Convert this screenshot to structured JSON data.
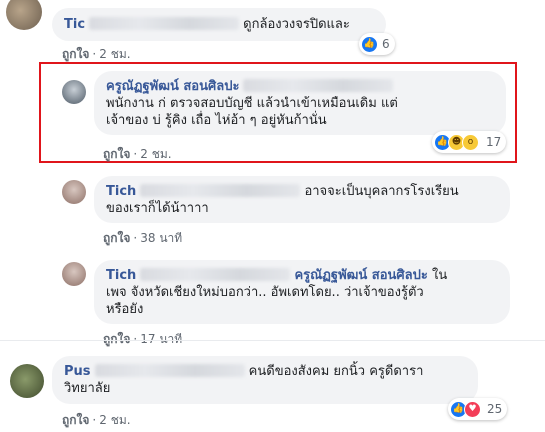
{
  "comments": [
    {
      "name": "Tic",
      "text": "ดูกล้องวงจรปิดและ",
      "like_label": "ถูกใจ",
      "time": "2 ชม.",
      "reaction_count": "6",
      "reactions": [
        "like-icon"
      ]
    },
    {
      "name": "ครูณัฏฐพัฒน์ สอนศิลปะ",
      "text_line1": "พนักงาน ก่ ตรวจสอบบัญชี แล้วนำเข้าเหมือนเดิม แต่",
      "text_line2": "เจ้าของ บ่ รู้คิง เถื่อ ไห่อ้า ๆ อยู่หันก้านั่น",
      "like_label": "ถูกใจ",
      "time": "2 ชม.",
      "reaction_count": "17",
      "reactions": [
        "like-icon",
        "haha-icon",
        "wow-icon"
      ]
    },
    {
      "name": "Tich",
      "text_line1": "อาจจะเป็นบุคลากรโรงเรียน",
      "text_line2": "ของเราก็ได้น้าาาา",
      "like_label": "ถูกใจ",
      "time": "38 นาที"
    },
    {
      "name": "Tich",
      "mention": "ครูณัฏฐพัฒน์ สอนศิลปะ",
      "text_line1_tail": "ใน",
      "text_line2": "เพจ จังหวัดเชียงใหม่บอกว่า.. อัพเดทโดย.. ว่าเจ้าของรู้ตัว",
      "text_line3": "หรือยัง",
      "like_label": "ถูกใจ",
      "time": "17 นาที"
    },
    {
      "name": "Pus",
      "text_line1": "คนดีของสังคม ยกนิ้ว ครูดีดารา",
      "text_line2": "วิทยาลัย",
      "like_label": "ถูกใจ",
      "time": "2 ชม.",
      "reaction_count": "25",
      "reactions": [
        "like-icon",
        "love-icon"
      ]
    }
  ],
  "colors": {
    "name_blue": "#385898",
    "bubble_bg": "#f2f3f5",
    "highlight_red": "#e0151b",
    "like_blue": "#1877f2"
  }
}
